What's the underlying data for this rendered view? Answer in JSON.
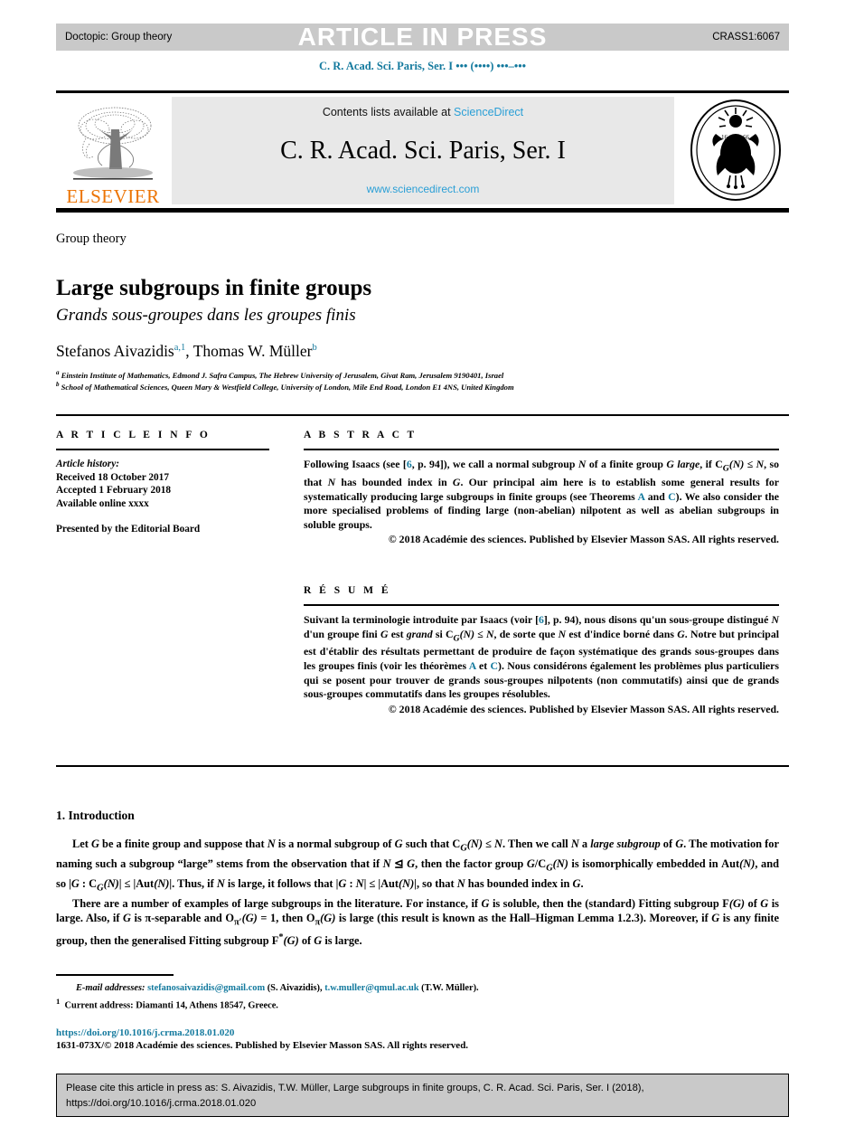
{
  "topbar": {
    "doctopic": "Doctopic: Group theory",
    "article_in_press": "ARTICLE IN PRESS",
    "crass_id": "CRASS1:6067"
  },
  "journal_ref": "C. R. Acad. Sci. Paris, Ser. I ••• (••••) •••–•••",
  "masthead": {
    "contents_prefix": "Contents lists available at ",
    "sciencedirect_link": "ScienceDirect",
    "journal_title": "C. R. Acad. Sci. Paris, Ser. I",
    "journal_url": "www.sciencedirect.com",
    "elsevier_wordmark": "ELSEVIER",
    "elsevier_logo_icon": "elsevier-tree-icon",
    "academie_seal_icon": "academie-des-sciences-seal-icon"
  },
  "article": {
    "section_label": "Group theory",
    "title": "Large subgroups in finite groups",
    "subtitle": "Grands sous-groupes dans les groupes finis",
    "authors": [
      {
        "name": "Stefanos Aivazidis",
        "marks": "a,1"
      },
      {
        "name": "Thomas W. Müller",
        "marks": "b"
      }
    ],
    "affiliations": [
      {
        "mark": "a",
        "text": "Einstein Institute of Mathematics, Edmond J. Safra Campus, The Hebrew University of Jerusalem, Givat Ram, Jerusalem 9190401, Israel"
      },
      {
        "mark": "b",
        "text": "School of Mathematical Sciences, Queen Mary & Westfield College, University of London, Mile End Road, London E1 4NS, United Kingdom"
      }
    ]
  },
  "info": {
    "heading": "A R T I C L E   I N F O",
    "history_label": "Article history:",
    "received": "Received 18 October 2017",
    "accepted": "Accepted 1 February 2018",
    "available": "Available online xxxx",
    "presented": "Presented by the Editorial Board"
  },
  "abstract": {
    "heading": "A B S T R A C T",
    "p1_a": "Following Isaacs (see [",
    "ref6": "6",
    "p1_b": ", p. 94]), we call a normal subgroup ",
    "N1": "N",
    "p1_c": " of a finite group ",
    "G1": "G",
    "p1_d": " ",
    "large_ital": "large",
    "p1_e": ", if ",
    "cg": "C",
    "cg_sub": "G",
    "cg_arg": "(N)",
    "le": " ≤ ",
    "N2": "N",
    "p1_f": ", so that ",
    "N3": "N",
    "p1_g": " has bounded index in ",
    "G2": "G",
    "p1_h": ". Our principal aim here is to establish some general results for systematically producing large subgroups in finite groups (see Theorems ",
    "thmA": "A",
    "p1_i": " and ",
    "thmC": "C",
    "p1_j": "). We also consider the more specialised problems of finding large (non-abelian) nilpotent as well as abelian subgroups in soluble groups.",
    "copyright": "© 2018 Académie des sciences. Published by Elsevier Masson SAS. All rights reserved."
  },
  "resume": {
    "heading": "R É S U M É",
    "p1_a": "Suivant la terminologie introduite par Isaacs (voir [",
    "ref6": "6",
    "p1_b": "], p. 94), nous disons qu'un sous-groupe distingué ",
    "N1": "N",
    "p1_c": " d'un groupe fini ",
    "G1": "G",
    "p1_d": " est ",
    "grand_ital": "grand",
    "p1_e": " si ",
    "cg": "C",
    "cg_sub": "G",
    "cg_arg": "(N)",
    "le": " ≤ ",
    "N2": "N",
    "p1_f": ", de sorte que ",
    "N3": "N",
    "p1_g": " est d'indice borné dans ",
    "G2": "G",
    "p1_h": ". Notre but principal est d'établir des résultats permettant de produire de façon systématique des grands sous-groupes dans les groupes finis (voir les théorèmes ",
    "thmA": "A",
    "p1_i": " et ",
    "thmC": "C",
    "p1_j": "). Nous considérons également les problèmes plus particuliers qui se posent pour trouver de grands sous-groupes nilpotents (non commutatifs) ainsi que de grands sous-groupes commutatifs dans les groupes résolubles.",
    "copyright": "© 2018 Académie des sciences. Published by Elsevier Masson SAS. All rights reserved."
  },
  "introduction": {
    "heading": "1. Introduction",
    "para1": "Let G be a finite group and suppose that N is a normal subgroup of G such that C_G(N) ≤ N. Then we call N a large subgroup of G. The motivation for naming such a subgroup \"large\" stems from the observation that if N ◁ G, then the factor group G/C_G(N) is isomorphically embedded in Aut(N), and so |G : C_G(N)| ≤ |Aut(N)|. Thus, if N is large, it follows that |G : N| ≤ |Aut(N)|, so that N has bounded index in G.",
    "para2": "There are a number of examples of large subgroups in the literature. For instance, if G is soluble, then the (standard) Fitting subgroup F(G) of G is large. Also, if G is π-separable and O_π′(G) = 1, then O_π(G) is large (this result is known as the Hall–Higman Lemma 1.2.3). Moreover, if G is any finite group, then the generalised Fitting subgroup F*(G) of G is large."
  },
  "footnotes": {
    "email_label": "E-mail addresses:",
    "email1": "stefanosaivazidis@gmail.com",
    "email1_who": " (S. Aivazidis), ",
    "email2": "t.w.muller@qmul.ac.uk",
    "email2_who": " (T.W. Müller).",
    "fn1_mark": "1",
    "fn1_text": "Current address: Diamanti 14, Athens 18547, Greece.",
    "doi": "https://doi.org/10.1016/j.crma.2018.01.020",
    "issn_line": "1631-073X/© 2018 Académie des sciences. Published by Elsevier Masson SAS. All rights reserved."
  },
  "citebox": {
    "line1": "Please cite this article in press as: S. Aivazidis, T.W. Müller, Large subgroups in finite groups, C. R. Acad. Sci. Paris, Ser. I (2018),",
    "line2": "https://doi.org/10.1016/j.crma.2018.01.020"
  },
  "colors": {
    "link_blue": "#147a9e",
    "sd_blue": "#2a9fd6",
    "elsevier_orange": "#ec7404",
    "bar_grey": "#c9c9c9",
    "masthead_grey": "#e8e8e8"
  }
}
